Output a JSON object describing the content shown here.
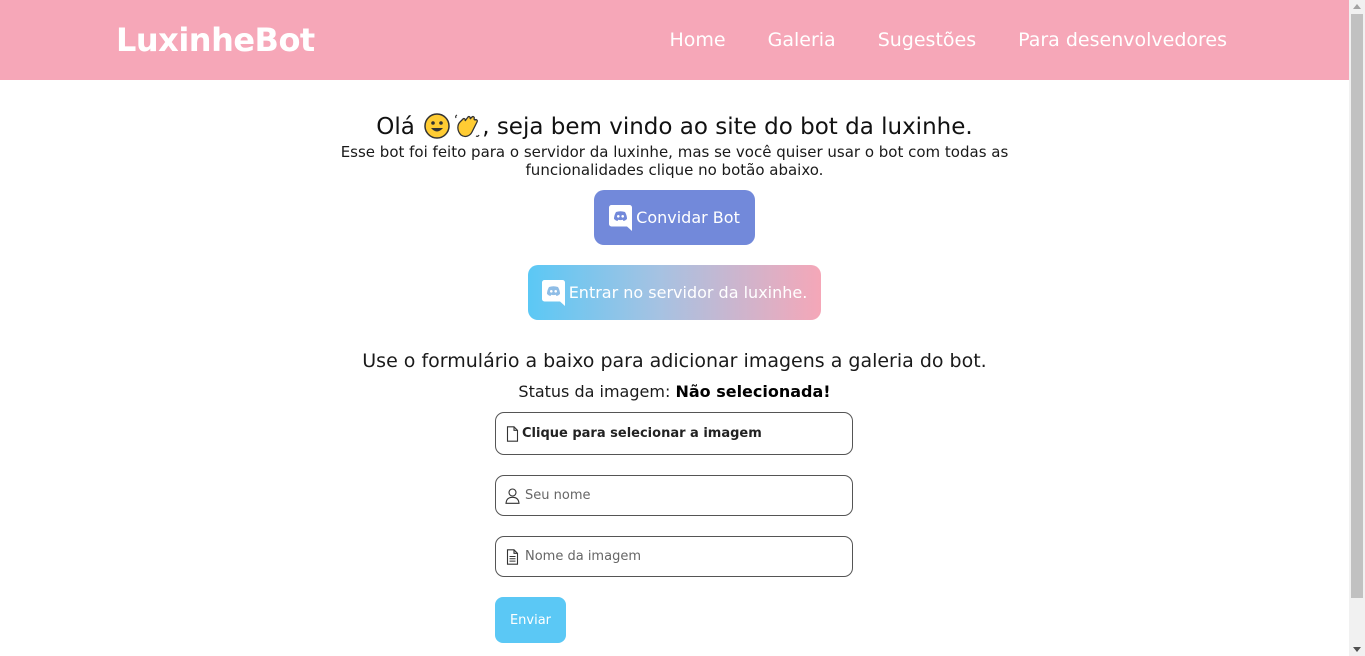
{
  "header": {
    "logo": "LuxinheBot",
    "nav": [
      "Home",
      "Galeria",
      "Sugestões",
      "Para desenvolvedores"
    ]
  },
  "greeting": {
    "before": "Olá",
    "after": ", seja bem vindo ao site do bot da luxinhe.",
    "emojis": [
      "grinning-face-emoji",
      "waving-hand-emoji"
    ]
  },
  "subtitle": {
    "line1": "Esse bot foi feito para o servidor da luxinhe, mas se você quiser usar o bot com todas as",
    "line2": "funcionalidades clique no botão abaixo."
  },
  "buttons": {
    "invite": "Convidar Bot",
    "join": "Entrar no servidor da luxinhe."
  },
  "form": {
    "title": "Use o formulário a baixo para adicionar imagens a galeria do bot.",
    "status_label": "Status da imagem:",
    "status_value": "Não selecionada!",
    "file_label": "Clique para selecionar a imagem",
    "name_placeholder": "Seu nome",
    "image_name_placeholder": "Nome da imagem",
    "submit": "Enviar"
  },
  "colors": {
    "header_bg": "#f6a7b8",
    "discord_blurple": "#7289da",
    "accent_blue": "#5bc8f5",
    "accent_pink": "#f5a7b8"
  }
}
